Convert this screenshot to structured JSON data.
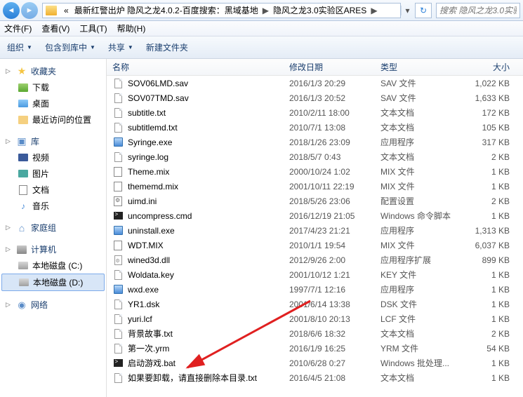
{
  "breadcrumb": {
    "prefix": "«",
    "items": [
      "最新红警出炉 隐风之龙4.0.2-百度搜索：黑域基地",
      "隐风之龙3.0实验区ARES"
    ]
  },
  "search": {
    "placeholder": "搜索 隐风之龙3.0实验"
  },
  "menubar": [
    "文件(F)",
    "查看(V)",
    "工具(T)",
    "帮助(H)"
  ],
  "toolbar": {
    "org": "组织",
    "include": "包含到库中",
    "share": "共享",
    "newfolder": "新建文件夹"
  },
  "columns": {
    "name": "名称",
    "date": "修改日期",
    "type": "类型",
    "size": "大小"
  },
  "sidebar": {
    "fav": {
      "label": "收藏夹",
      "items": [
        "下载",
        "桌面",
        "最近访问的位置"
      ]
    },
    "lib": {
      "label": "库",
      "items": [
        "视频",
        "图片",
        "文档",
        "音乐"
      ]
    },
    "home": {
      "label": "家庭组"
    },
    "pc": {
      "label": "计算机",
      "items": [
        "本地磁盘 (C:)",
        "本地磁盘 (D:)"
      ]
    },
    "net": {
      "label": "网络"
    }
  },
  "files": [
    {
      "n": "SOV06LMD.sav",
      "d": "2016/1/3 20:29",
      "t": "SAV 文件",
      "s": "1,022 KB",
      "ic": "file"
    },
    {
      "n": "SOV07TMD.sav",
      "d": "2016/1/3 20:52",
      "t": "SAV 文件",
      "s": "1,633 KB",
      "ic": "file"
    },
    {
      "n": "subtitle.txt",
      "d": "2010/2/11 18:00",
      "t": "文本文档",
      "s": "172 KB",
      "ic": "file"
    },
    {
      "n": "subtitlemd.txt",
      "d": "2010/7/1 13:08",
      "t": "文本文档",
      "s": "105 KB",
      "ic": "file"
    },
    {
      "n": "Syringe.exe",
      "d": "2018/1/26 23:09",
      "t": "应用程序",
      "s": "317 KB",
      "ic": "exe"
    },
    {
      "n": "syringe.log",
      "d": "2018/5/7 0:43",
      "t": "文本文档",
      "s": "2 KB",
      "ic": "file"
    },
    {
      "n": "Theme.mix",
      "d": "2000/10/24 1:02",
      "t": "MIX 文件",
      "s": "1 KB",
      "ic": "mix"
    },
    {
      "n": "thememd.mix",
      "d": "2001/10/11 22:19",
      "t": "MIX 文件",
      "s": "1 KB",
      "ic": "mix"
    },
    {
      "n": "uimd.ini",
      "d": "2018/5/26 23:06",
      "t": "配置设置",
      "s": "2 KB",
      "ic": "ini"
    },
    {
      "n": "uncompress.cmd",
      "d": "2016/12/19 21:05",
      "t": "Windows 命令脚本",
      "s": "1 KB",
      "ic": "cmd"
    },
    {
      "n": "uninstall.exe",
      "d": "2017/4/23 21:21",
      "t": "应用程序",
      "s": "1,313 KB",
      "ic": "exe"
    },
    {
      "n": "WDT.MIX",
      "d": "2010/1/1 19:54",
      "t": "MIX 文件",
      "s": "6,037 KB",
      "ic": "mix"
    },
    {
      "n": "wined3d.dll",
      "d": "2012/9/26 2:00",
      "t": "应用程序扩展",
      "s": "899 KB",
      "ic": "dll"
    },
    {
      "n": "Woldata.key",
      "d": "2001/10/12 1:21",
      "t": "KEY 文件",
      "s": "1 KB",
      "ic": "file"
    },
    {
      "n": "wxd.exe",
      "d": "1997/7/1 12:16",
      "t": "应用程序",
      "s": "1 KB",
      "ic": "exe"
    },
    {
      "n": "YR1.dsk",
      "d": "2001/6/14 13:38",
      "t": "DSK 文件",
      "s": "1 KB",
      "ic": "file"
    },
    {
      "n": "yuri.lcf",
      "d": "2001/8/10 20:13",
      "t": "LCF 文件",
      "s": "1 KB",
      "ic": "file"
    },
    {
      "n": "背景故事.txt",
      "d": "2018/6/6 18:32",
      "t": "文本文档",
      "s": "2 KB",
      "ic": "file"
    },
    {
      "n": "第一次.yrm",
      "d": "2016/1/9 16:25",
      "t": "YRM 文件",
      "s": "54 KB",
      "ic": "file"
    },
    {
      "n": "启动游戏.bat",
      "d": "2010/6/28 0:27",
      "t": "Windows 批处理...",
      "s": "1 KB",
      "ic": "cmd"
    },
    {
      "n": "如果要卸载，请直接删除本目录.txt",
      "d": "2016/4/5 21:08",
      "t": "文本文档",
      "s": "1 KB",
      "ic": "file"
    }
  ]
}
